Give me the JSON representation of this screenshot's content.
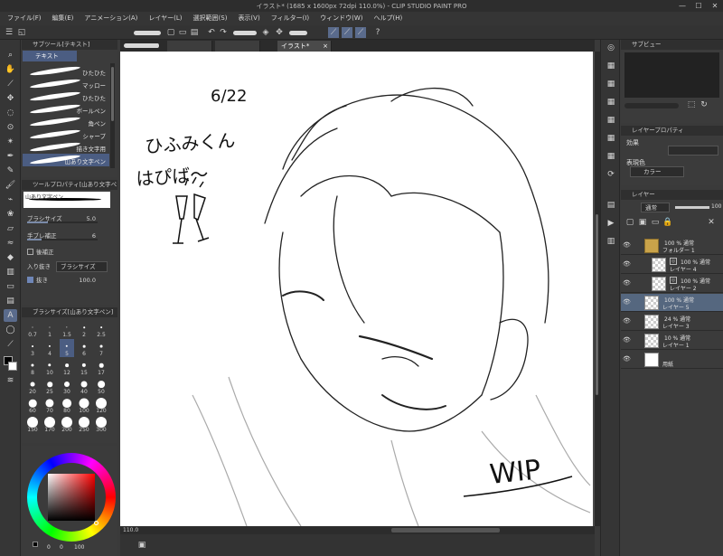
{
  "window": {
    "title": "イラスト* (1685 x 1600px 72dpi 110.0%) - CLIP STUDIO PAINT PRO",
    "minimize": "—",
    "maximize": "☐",
    "close": "✕"
  },
  "menu": [
    "ファイル(F)",
    "編集(E)",
    "アニメーション(A)",
    "レイヤー(L)",
    "選択範囲(S)",
    "表示(V)",
    "フィルター(I)",
    "ウィンドウ(W)",
    "ヘルプ(H)"
  ],
  "doc_tab": {
    "label": "イラスト*",
    "close": "×"
  },
  "subtool_panel": {
    "title": "サブツール[テキスト]",
    "active_tab": "テキスト",
    "brushes": [
      "ひたひた",
      "マッロー",
      "ひたひた",
      "ボールペン",
      "角ペン",
      "シャープ",
      "描き文字用",
      "山あり文字ペン"
    ]
  },
  "tool_property": {
    "title": "ツールプロパティ[山あり文字ペン]",
    "brush_name": "山あり文字ペン",
    "brush_size_label": "ブラシサイズ",
    "brush_size_value": "5.0",
    "stabilization_label": "手ブレ補正",
    "stabilization_value": "6",
    "post_correction_label": "後補正",
    "taper_label": "入り抜き",
    "taper_dropdown": "ブラシサイズ",
    "taper_check_label": "抜き",
    "taper_value": "100.0"
  },
  "brush_size_panel": {
    "title": "ブラシサイズ[山あり文字ペン]",
    "sizes": [
      "0.7",
      "1",
      "1.5",
      "2",
      "2.5",
      "3",
      "4",
      "5",
      "6",
      "7",
      "8",
      "10",
      "12",
      "15",
      "17",
      "20",
      "25",
      "30",
      "40",
      "50",
      "60",
      "70",
      "80",
      "100",
      "120",
      "150",
      "170",
      "200",
      "250",
      "300"
    ],
    "selected": "5"
  },
  "colors": {
    "main": "#000000",
    "sub": "#ffffff",
    "panel_accent": "#4b5d82"
  },
  "status": {
    "zoom": "110.0"
  },
  "canvas_drawing": {
    "date": "6/22",
    "message_line1": "ひふみくん",
    "message_line2": "はぴば〜",
    "wip": "WIP"
  },
  "sub_view": {
    "title": "サブビュー"
  },
  "layer_property": {
    "title": "レイヤープロパティ",
    "effect_label": "効果",
    "expression_color_label": "表現色",
    "expression_color_value": "カラー"
  },
  "layer_panel": {
    "title": "レイヤー",
    "blend_mode": "通常",
    "opacity": "100",
    "layers": [
      {
        "line1": "100 % 通常",
        "line2": "フォルダー 1",
        "type": "folder"
      },
      {
        "line1": "100 % 通常",
        "line2": "レイヤー 4",
        "type": "raster"
      },
      {
        "line1": "100 % 通常",
        "line2": "レイヤー 2",
        "type": "raster"
      },
      {
        "line1": "100 % 通常",
        "line2": "レイヤー 5",
        "type": "raster",
        "selected": true
      },
      {
        "line1": "24 % 通常",
        "line2": "レイヤー 3",
        "type": "raster"
      },
      {
        "line1": "10 % 通常",
        "line2": "レイヤー 1",
        "type": "raster"
      },
      {
        "line1": "",
        "line2": "用紙",
        "type": "paper"
      }
    ]
  },
  "color_wheel_values": {
    "h": "0",
    "s": "0",
    "v": "100"
  }
}
